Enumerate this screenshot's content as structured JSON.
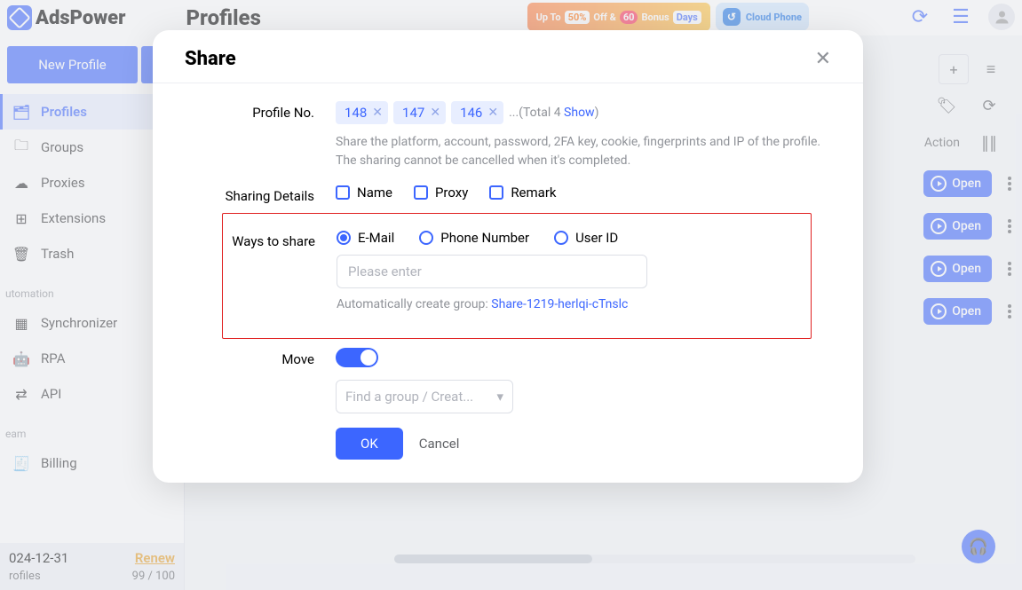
{
  "app": {
    "name": "AdsPower"
  },
  "page": {
    "title": "Profiles"
  },
  "promo": {
    "upto": "Up To",
    "fifty": "50%",
    "off": "Off &",
    "sixty": "60",
    "bonus": "Bonus",
    "days": "Days"
  },
  "cloud_phone": "Cloud Phone",
  "sidebar": {
    "new_profile": "New Profile",
    "items": [
      {
        "label": "Profiles"
      },
      {
        "label": "Groups"
      },
      {
        "label": "Proxies"
      },
      {
        "label": "Extensions"
      },
      {
        "label": "Trash"
      }
    ],
    "section_automation": "utomation",
    "automation": [
      {
        "label": "Synchronizer"
      },
      {
        "label": "RPA"
      },
      {
        "label": "API"
      }
    ],
    "section_team": "eam",
    "team": [
      {
        "label": "Billing"
      }
    ],
    "footer": {
      "expiry": "024-12-31",
      "renew": "Renew",
      "profiles_label": "rofiles",
      "profiles_count": "99 / 100"
    }
  },
  "table": {
    "action_header": "Action",
    "open_label": "Open"
  },
  "modal": {
    "title": "Share",
    "profile_no_label": "Profile No.",
    "tags": [
      "148",
      "147",
      "146"
    ],
    "total_prefix": "...(Total 4 ",
    "total_show": "Show",
    "total_suffix": ")",
    "helper": "Share the platform, account, password, 2FA key, cookie, fingerprints and IP of the profile. The sharing cannot be cancelled when it's completed.",
    "sharing_details_label": "Sharing Details",
    "chk_name": "Name",
    "chk_proxy": "Proxy",
    "chk_remark": "Remark",
    "ways_label": "Ways to share",
    "rad_email": "E-Mail",
    "rad_phone": "Phone Number",
    "rad_user": "User ID",
    "input_placeholder": "Please enter",
    "auto_group_prefix": "Automatically create group: ",
    "auto_group_name": "Share-1219-herlqi-cTnslc",
    "move_label": "Move",
    "group_placeholder": "Find a group / Creat...",
    "ok": "OK",
    "cancel": "Cancel"
  }
}
